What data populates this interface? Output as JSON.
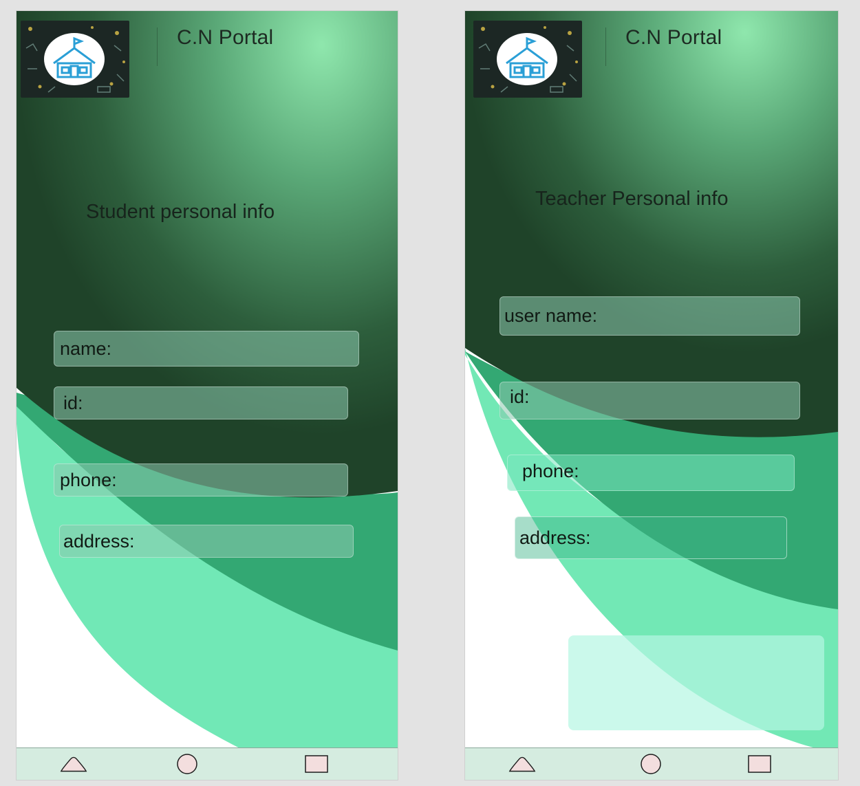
{
  "student": {
    "portal_title": "C.N Portal",
    "form_title": "Student personal info",
    "fields": [
      {
        "label": "name:"
      },
      {
        "label": "id:"
      },
      {
        "label": "phone:"
      },
      {
        "label": "address:"
      }
    ]
  },
  "teacher": {
    "portal_title": "C.N Portal",
    "form_title": "Teacher Personal info",
    "fields": [
      {
        "label": "user name:"
      },
      {
        "label": "id:"
      },
      {
        "label": "phone:"
      },
      {
        "label": "address:"
      }
    ]
  },
  "navbar": {
    "icons": [
      "back-triangle-icon",
      "home-circle-icon",
      "recents-square-icon"
    ]
  },
  "colors": {
    "dark_green": "#1f4a2b",
    "mid_green": "#33a873",
    "light_green": "#72e6b4",
    "header_green": "#8be3a8",
    "field_fill": "#8cc8af",
    "navbar_bg": "#d5ece0",
    "nav_icon_fill": "#f3dede"
  }
}
